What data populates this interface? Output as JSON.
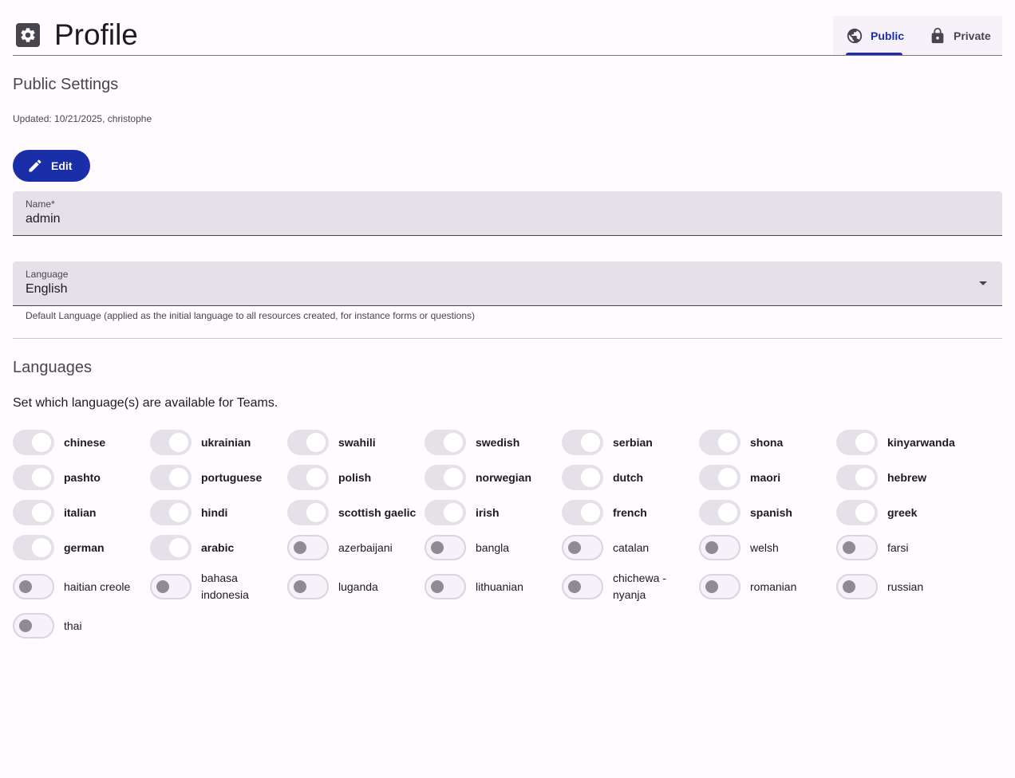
{
  "header": {
    "title": "Profile",
    "settings_icon": "gear-icon"
  },
  "tabs": [
    {
      "label": "Public",
      "icon": "globe-icon",
      "active": true
    },
    {
      "label": "Private",
      "icon": "lock-icon",
      "active": false
    }
  ],
  "public_settings": {
    "title": "Public Settings",
    "updated": "Updated: 10/21/2025, christophe",
    "edit_label": "Edit"
  },
  "name_field": {
    "label": "Name*",
    "value": "admin"
  },
  "language_field": {
    "label": "Language",
    "value": "English",
    "helper": "Default Language (applied as the initial language to all resources created, for instance forms or questions)"
  },
  "languages": {
    "title": "Languages",
    "description": "Set which language(s) are available for Teams.",
    "items": [
      {
        "label": "chinese",
        "enabled": true
      },
      {
        "label": "ukrainian",
        "enabled": true
      },
      {
        "label": "swahili",
        "enabled": true
      },
      {
        "label": "swedish",
        "enabled": true
      },
      {
        "label": "serbian",
        "enabled": true
      },
      {
        "label": "shona",
        "enabled": true
      },
      {
        "label": "kinyarwanda",
        "enabled": true
      },
      {
        "label": "pashto",
        "enabled": true
      },
      {
        "label": "portuguese",
        "enabled": true
      },
      {
        "label": "polish",
        "enabled": true
      },
      {
        "label": "norwegian",
        "enabled": true
      },
      {
        "label": "dutch",
        "enabled": true
      },
      {
        "label": "maori",
        "enabled": true
      },
      {
        "label": "hebrew",
        "enabled": true
      },
      {
        "label": "italian",
        "enabled": true
      },
      {
        "label": "hindi",
        "enabled": true
      },
      {
        "label": "scottish gaelic",
        "enabled": true
      },
      {
        "label": "irish",
        "enabled": true
      },
      {
        "label": "french",
        "enabled": true
      },
      {
        "label": "spanish",
        "enabled": true
      },
      {
        "label": "greek",
        "enabled": true
      },
      {
        "label": "german",
        "enabled": true
      },
      {
        "label": "arabic",
        "enabled": true
      },
      {
        "label": "azerbaijani",
        "enabled": false
      },
      {
        "label": "bangla",
        "enabled": false
      },
      {
        "label": "catalan",
        "enabled": false
      },
      {
        "label": "welsh",
        "enabled": false
      },
      {
        "label": "farsi",
        "enabled": false
      },
      {
        "label": "haitian creole",
        "enabled": false
      },
      {
        "label": "bahasa indonesia",
        "enabled": false
      },
      {
        "label": "luganda",
        "enabled": false
      },
      {
        "label": "lithuanian",
        "enabled": false
      },
      {
        "label": "chichewa - nyanja",
        "enabled": false
      },
      {
        "label": "romanian",
        "enabled": false
      },
      {
        "label": "russian",
        "enabled": false
      },
      {
        "label": "thai",
        "enabled": false
      }
    ]
  },
  "colors": {
    "primary": "#1a2ea7",
    "surface": "#e6e0e9",
    "background": "#fffbfe"
  }
}
